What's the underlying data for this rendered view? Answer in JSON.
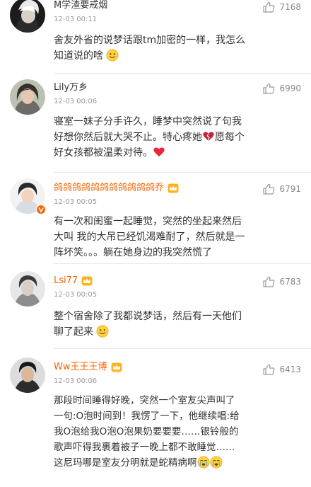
{
  "comments": [
    {
      "username": "M学渣要戒烟",
      "time": "12-03 00:11",
      "likes": "7168",
      "lines": [
        "舍友外省的说梦话跟tm加密的一样，我怎么",
        "知道说的啥"
      ],
      "line_emoji": [
        "",
        "smile-emoji"
      ]
    },
    {
      "username": "Lily万乡",
      "time": "12-03 00:06",
      "likes": "6990",
      "lines": [
        "寝室一妹子分手许久，睡梦中突然说了句我",
        "好想你然后就大哭不止。特心疼她",
        "好女孩都被温柔对待。"
      ],
      "line2_tail": "愿每个"
    },
    {
      "username": "鸽鸽鸽鸽鸽鸽鸽鸽鸽鸽鸽乔",
      "time": "12-03 00:05",
      "likes": "6791",
      "lines": [
        "有一次和闺蜜一起睡觉，突然的坐起来然后",
        "大叫 我的大吊已经饥渴难耐了，然后就是一",
        "阵坏笑。。。躺在她身边的我突然慌了"
      ]
    },
    {
      "username": "Lsi77",
      "time": "12-03 00:05",
      "likes": "6783",
      "lines": [
        "整个宿舍除了我都说梦话，然后有一天他们",
        "聊了起来"
      ]
    },
    {
      "username": "Ww王王王博",
      "time": "12-03 00:06",
      "likes": "6413",
      "lines": [
        "那段时间睡得好晚，突然一个室友尖声叫了",
        "一句:O泡时间到！我愣了一下，他继续唱:给",
        "我O泡给我O泡O泡果奶要要要……银铃般的",
        "歌声吓得我裹着被子一晚上都不敢睡觉……",
        "这尼玛哪是室友分明就是蛇精病啊"
      ]
    }
  ],
  "colors": {
    "vip_name": "#f86400",
    "text": "#333333",
    "meta": "#999999"
  },
  "icons": {
    "like": "thumbs-up-icon",
    "vip_badge": "crown-badge-icon",
    "verified": "verified-v-icon"
  }
}
